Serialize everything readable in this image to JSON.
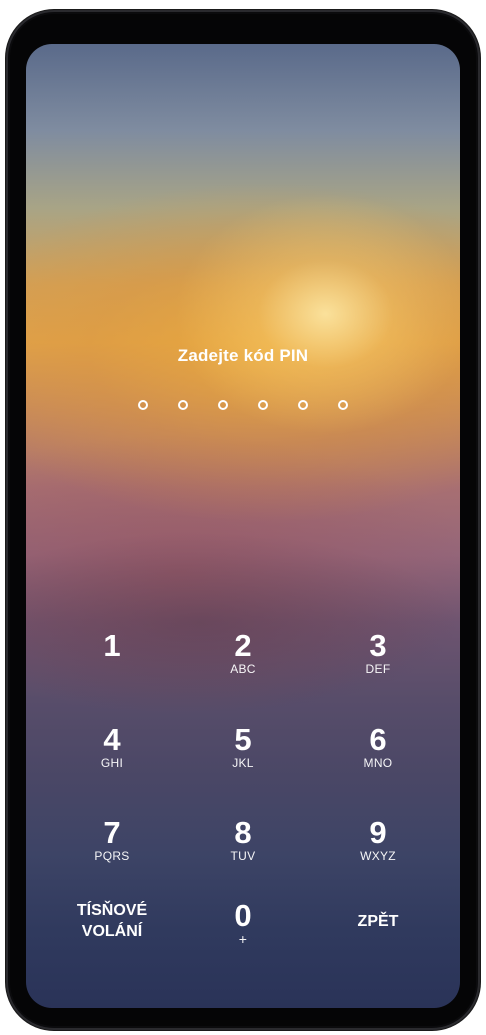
{
  "lockscreen": {
    "prompt": "Zadejte kód PIN",
    "pin_dot_count": 6,
    "keys": [
      {
        "digit": "1",
        "letters": ""
      },
      {
        "digit": "2",
        "letters": "ABC"
      },
      {
        "digit": "3",
        "letters": "DEF"
      },
      {
        "digit": "4",
        "letters": "GHI"
      },
      {
        "digit": "5",
        "letters": "JKL"
      },
      {
        "digit": "6",
        "letters": "MNO"
      },
      {
        "digit": "7",
        "letters": "PQRS"
      },
      {
        "digit": "8",
        "letters": "TUV"
      },
      {
        "digit": "9",
        "letters": "WXYZ"
      },
      {
        "digit": "0",
        "letters": "+"
      }
    ],
    "emergency": {
      "line1": "TÍSŇOVÉ",
      "line2": "VOLÁNÍ"
    },
    "back_label": "ZPĚT"
  }
}
